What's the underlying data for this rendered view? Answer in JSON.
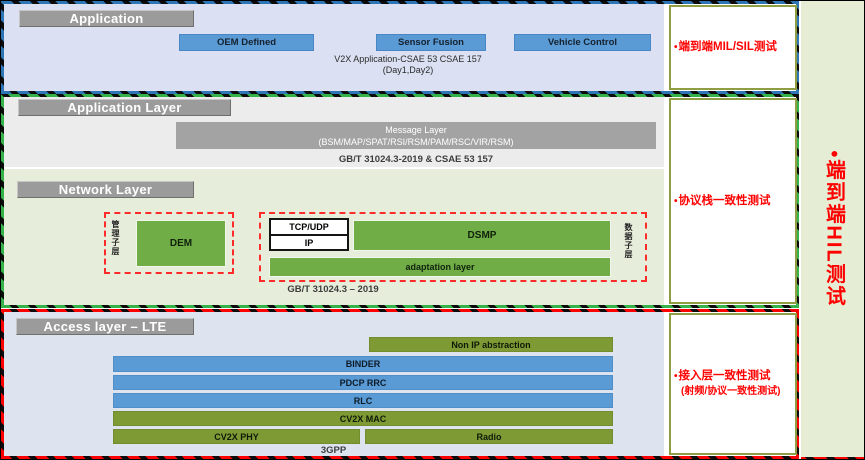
{
  "palette": {
    "app_band_dash": "#2e75b6",
    "middle_band_dash": "#35b34a",
    "access_band_dash": "#ff0000",
    "app_bg": "#dbe1f2",
    "app_layer_bg": "#ececec",
    "network_bg": "#e6eedb",
    "access_bg": "#dde4f0",
    "side_bg": "#e5edd5",
    "header_gray": "#9b9b9b",
    "box_blue": "#5b9bd5",
    "box_green": "#70ad47",
    "bar_olive": "#7e9a35",
    "annotation_red": "#ff0000",
    "annotation_border": "#8f9e43"
  },
  "application": {
    "title": "Application",
    "boxes": [
      "OEM Defined",
      "Sensor Fusion",
      "Vehicle Control"
    ],
    "caption_line1": "V2X Application-CSAE 53 CSAE 157",
    "caption_line2": "(Day1,Day2)"
  },
  "application_layer": {
    "title": "Application Layer",
    "message_layer_line1": "Message Layer",
    "message_layer_line2": "(BSM/MAP/SPAT/RSI/RSM/PAM/RSC/VIR/RSM)",
    "caption": "GB/T 31024.3-2019 & CSAE 53 157"
  },
  "network_layer": {
    "title": "Network Layer",
    "management_sublayer": "管理子层",
    "dem": "DEM",
    "tcp_udp": "TCP/UDP",
    "ip": "IP",
    "dsmp": "DSMP",
    "adaptation": "adaptation layer",
    "data_sublayer": "数据子层",
    "caption": "GB/T 31024.3 – 2019"
  },
  "access_layer": {
    "title": "Access layer – LTE",
    "non_ip": "Non IP abstraction",
    "binder": "BINDER",
    "pdcp_rrc": "PDCP RRC",
    "rlc": "RLC",
    "cv2x_mac": "CV2X MAC",
    "cv2x_phy": "CV2X PHY",
    "radio": "Radio",
    "caption": "3GPP"
  },
  "tests": {
    "bullet": "•",
    "mil_sil": "端到端MIL/SIL测试",
    "protocol_stack": "协议栈一致性测试",
    "access_line1": "接入层一致性测试",
    "access_line2": "(射频/协议一致性测试)",
    "hil": "端到端HIL测试"
  }
}
